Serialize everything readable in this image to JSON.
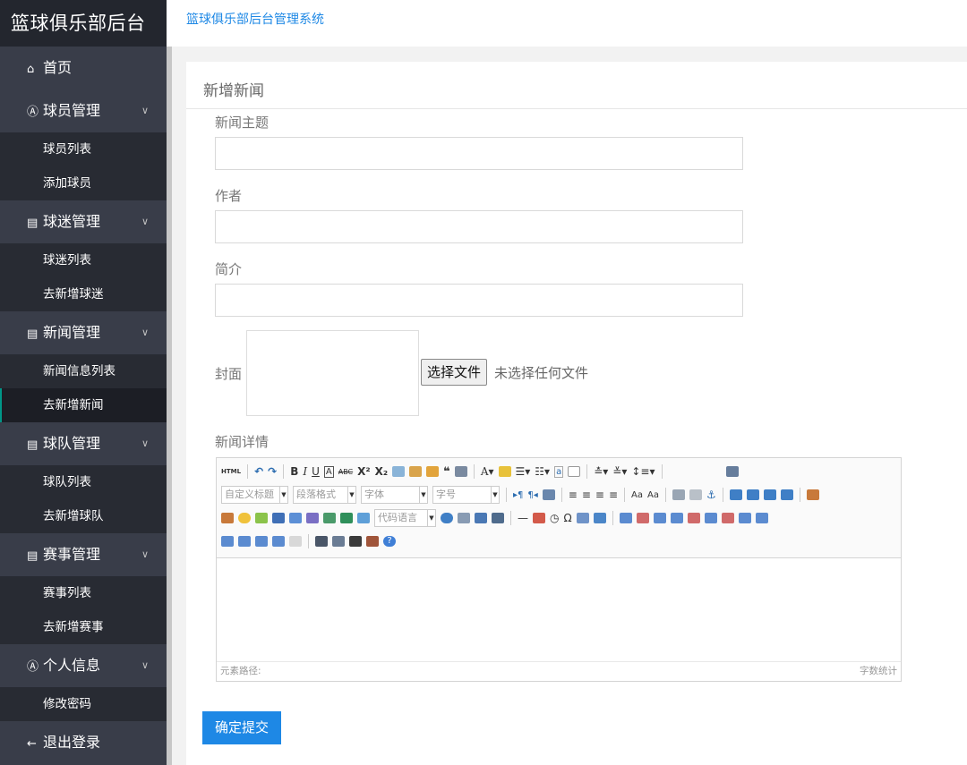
{
  "app": {
    "logo": "篮球俱乐部后台",
    "header_title": "篮球俱乐部后台管理系统"
  },
  "sidebar": {
    "home": {
      "icon": "home-icon",
      "label": "首页"
    },
    "groups": [
      {
        "icon": "user-circle-icon",
        "label": "球员管理",
        "items": [
          "球员列表",
          "添加球员"
        ]
      },
      {
        "icon": "document-icon",
        "label": "球迷管理",
        "items": [
          "球迷列表",
          "去新增球迷"
        ]
      },
      {
        "icon": "document-icon",
        "label": "新闻管理",
        "items": [
          "新闻信息列表",
          "去新增新闻"
        ]
      },
      {
        "icon": "document-icon",
        "label": "球队管理",
        "items": [
          "球队列表",
          "去新增球队"
        ]
      },
      {
        "icon": "document-icon",
        "label": "赛事管理",
        "items": [
          "赛事列表",
          "去新增赛事"
        ]
      },
      {
        "icon": "user-circle-icon",
        "label": "个人信息",
        "items": [
          "修改密码"
        ]
      }
    ],
    "logout": {
      "icon": "arrow-left-icon",
      "label": "退出登录"
    },
    "active_item": "去新增新闻"
  },
  "form": {
    "title": "新增新闻",
    "subject_label": "新闻主题",
    "subject_value": "",
    "author_label": "作者",
    "author_value": "",
    "intro_label": "简介",
    "intro_value": "",
    "cover_label": "封面",
    "file_button": "选择文件",
    "file_status": "未选择任何文件",
    "detail_label": "新闻详情",
    "submit_label": "确定提交"
  },
  "editor": {
    "selects": [
      "自定义标题",
      "段落格式",
      "字体",
      "字号",
      "代码语言"
    ],
    "status_left": "元素路径:",
    "status_right": "字数统计"
  },
  "colors": {
    "accent": "#1e88e5",
    "sidebar": "#393d49",
    "logo_bg": "#23262e",
    "submenu": "#282b33"
  }
}
